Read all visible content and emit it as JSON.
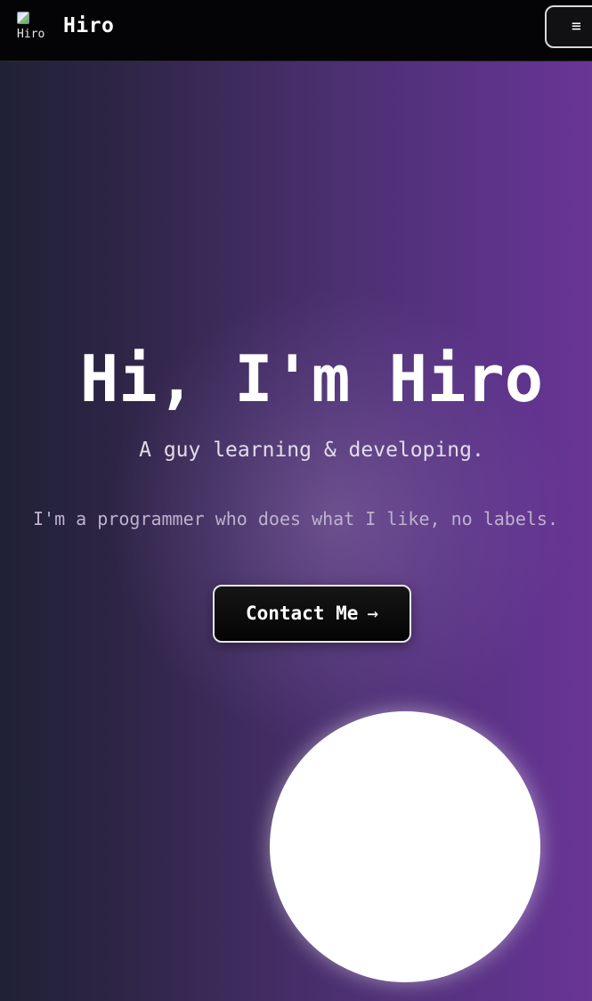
{
  "navbar": {
    "logo_alt": "Hiro",
    "brand": "Hiro",
    "menu_icon": "≡"
  },
  "hero": {
    "title": "Hi, I'm Hiro",
    "subtitle": "A guy learning & developing.",
    "description": "I'm a programmer who does what I like, no labels.",
    "cta_label": "Contact Me",
    "cta_arrow": "→"
  },
  "colors": {
    "navbar_bg": "#040406",
    "gradient_start": "#1f2136",
    "gradient_end": "#6a3596",
    "button_bg": "#0a0a0a",
    "text_primary": "#ffffff"
  },
  "icons": {
    "menu": "hamburger-menu-icon",
    "arrow": "arrow-right-icon"
  }
}
